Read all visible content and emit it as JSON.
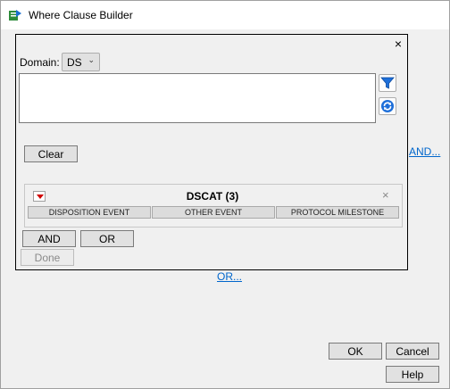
{
  "window": {
    "title": "Where Clause Builder"
  },
  "panel": {
    "close_symbol": "×",
    "domain_label": "Domain:",
    "domain_value": "DS",
    "clear_label": "Clear",
    "filter": {
      "title": "DSCAT (3)",
      "close_symbol": "×",
      "options": [
        "DISPOSITION EVENT",
        "OTHER EVENT",
        "PROTOCOL MILESTONE"
      ]
    },
    "and_label": "AND",
    "or_label": "OR",
    "done_label": "Done"
  },
  "links": {
    "and": "AND...",
    "or": "OR..."
  },
  "footer": {
    "ok_label": "OK",
    "cancel_label": "Cancel",
    "help_label": "Help"
  },
  "colors": {
    "link": "#0066cc",
    "accent_red": "#d00000",
    "filter_blue": "#1e6fd9"
  }
}
